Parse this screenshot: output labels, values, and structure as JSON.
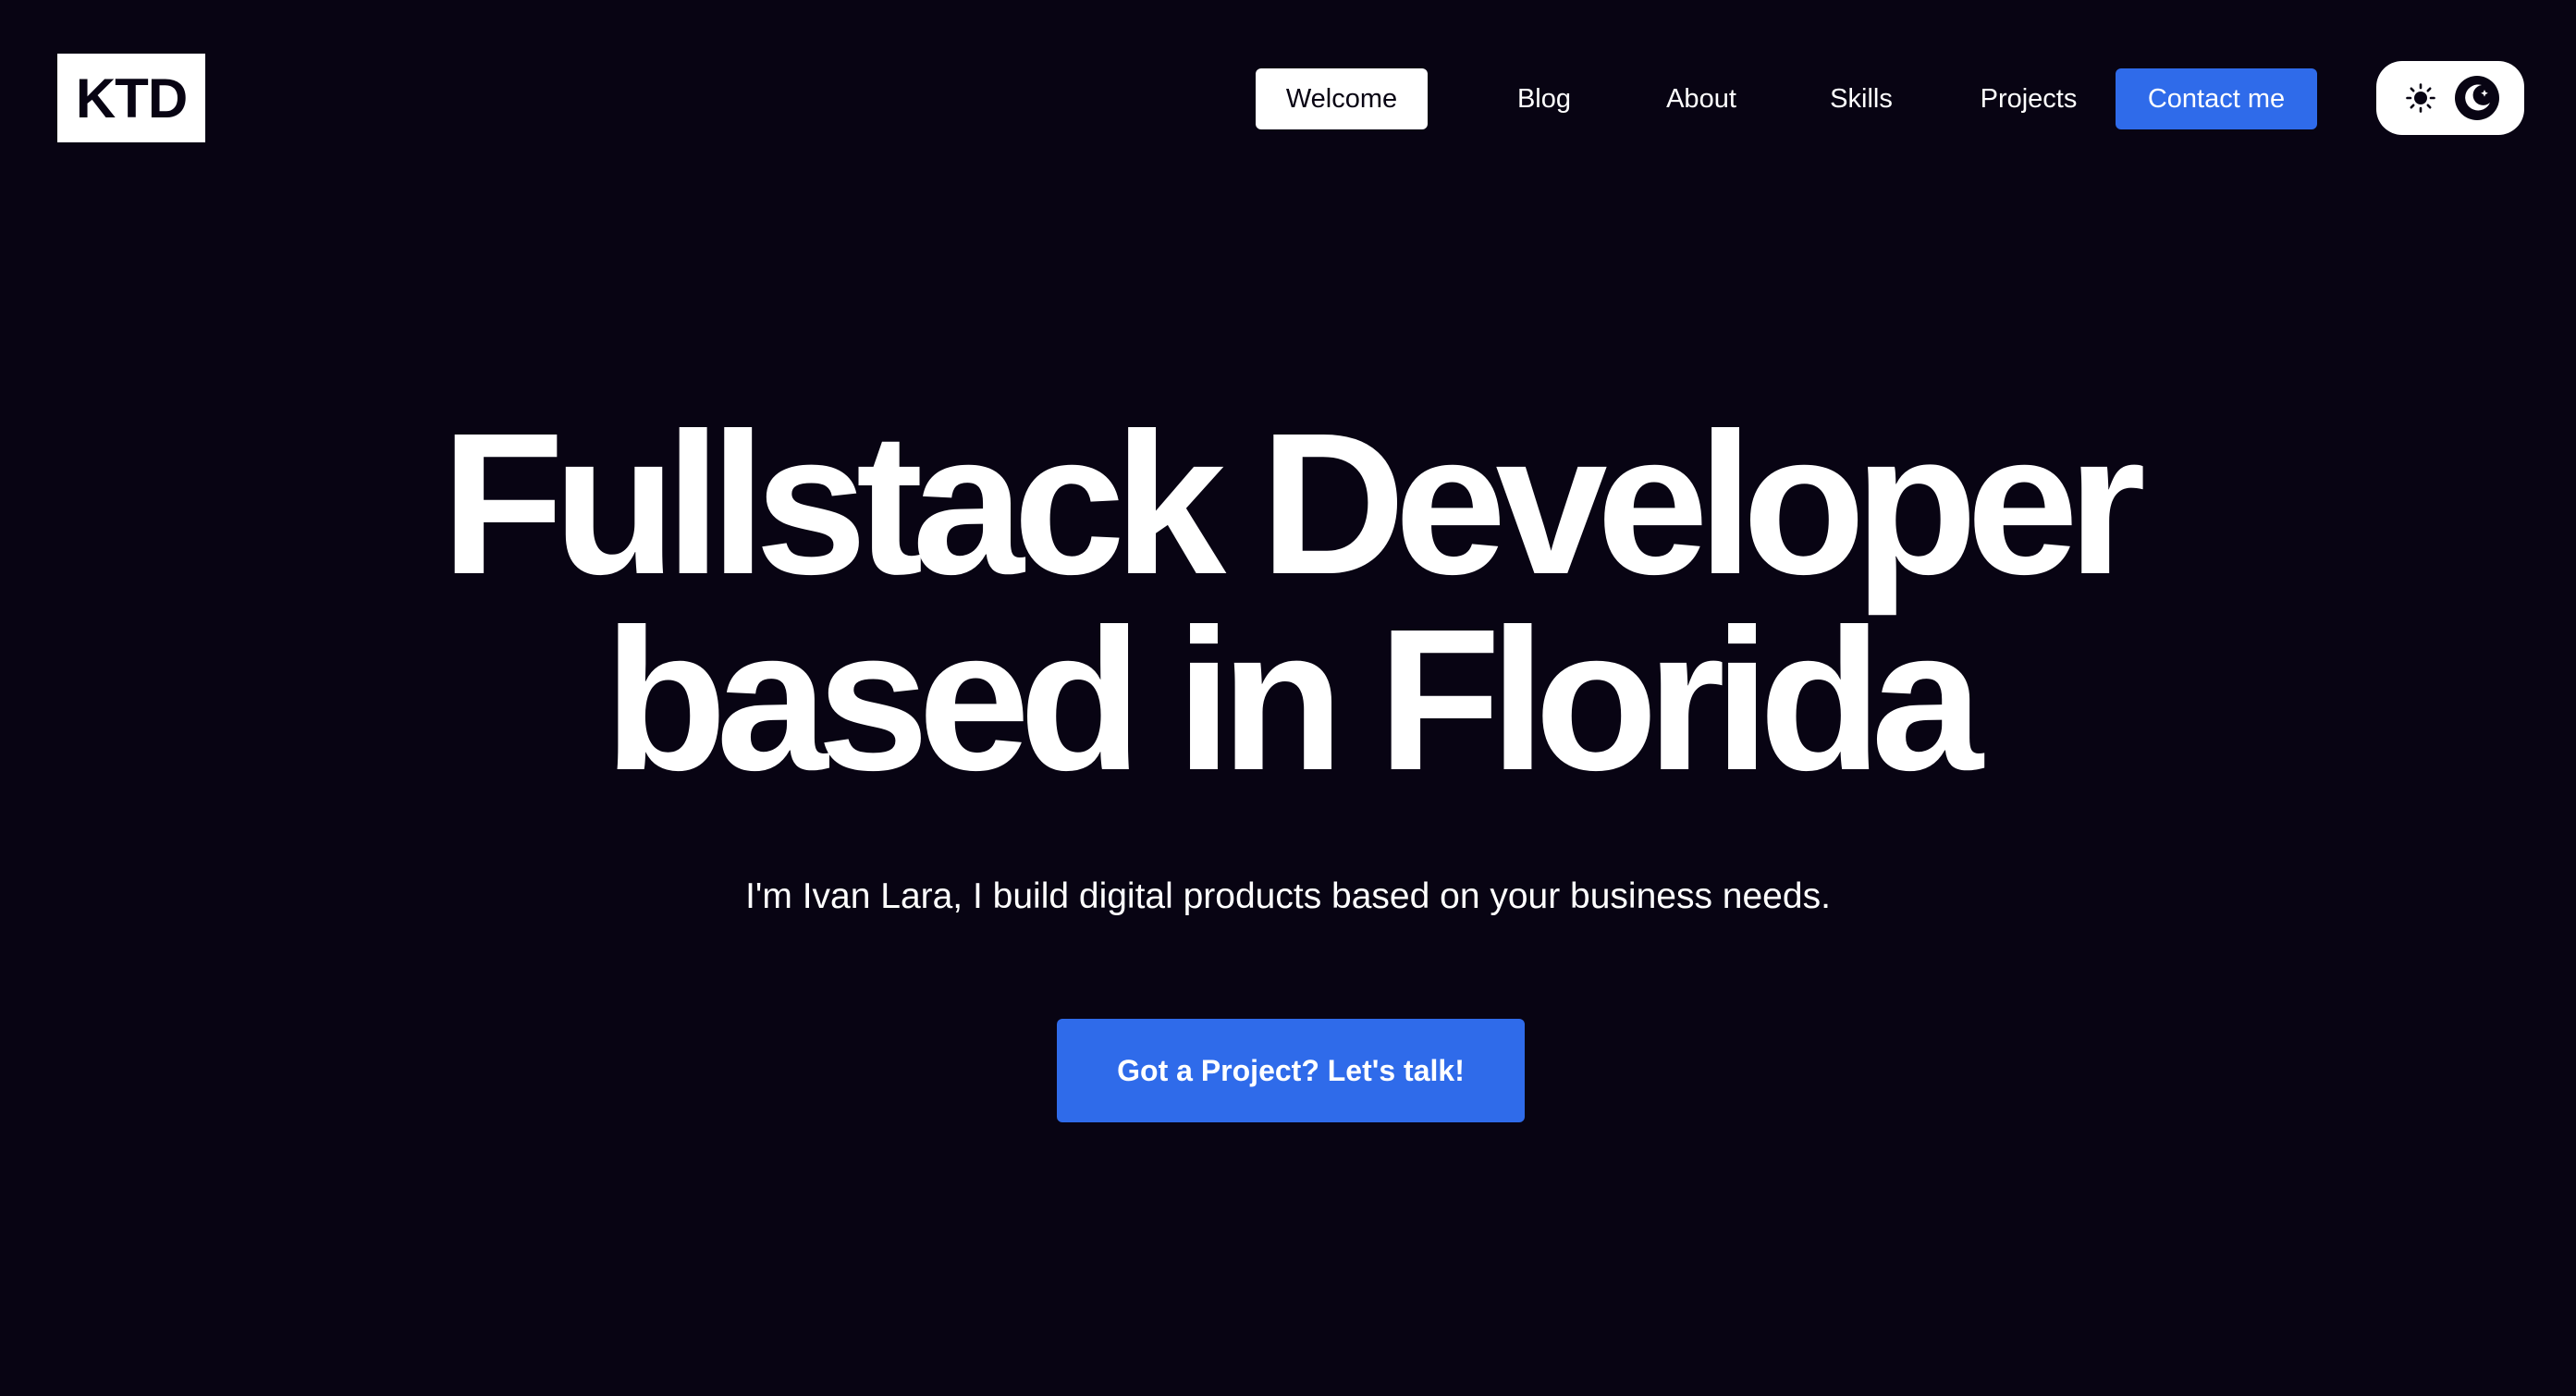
{
  "logo": {
    "text": "KTD"
  },
  "nav": {
    "items": [
      {
        "label": "Welcome",
        "state": "active"
      },
      {
        "label": "Blog",
        "state": "default"
      },
      {
        "label": "About",
        "state": "default"
      },
      {
        "label": "Skills",
        "state": "default"
      },
      {
        "label": "Projects",
        "state": "default"
      },
      {
        "label": "Contact me",
        "state": "primary"
      }
    ]
  },
  "theme_toggle": {
    "options": [
      {
        "icon": "sun-icon"
      },
      {
        "icon": "moon-icon"
      }
    ],
    "selected": "moon-icon"
  },
  "hero": {
    "title_line1": "Fullstack Developer",
    "title_line2": "based in Florida",
    "subtitle": "I'm Ivan Lara, I build digital products based on your business needs.",
    "cta_label": "Got a Project? Let's talk!"
  },
  "colors": {
    "background": "#080413",
    "accent": "#2f6bea",
    "text": "#ffffff"
  }
}
